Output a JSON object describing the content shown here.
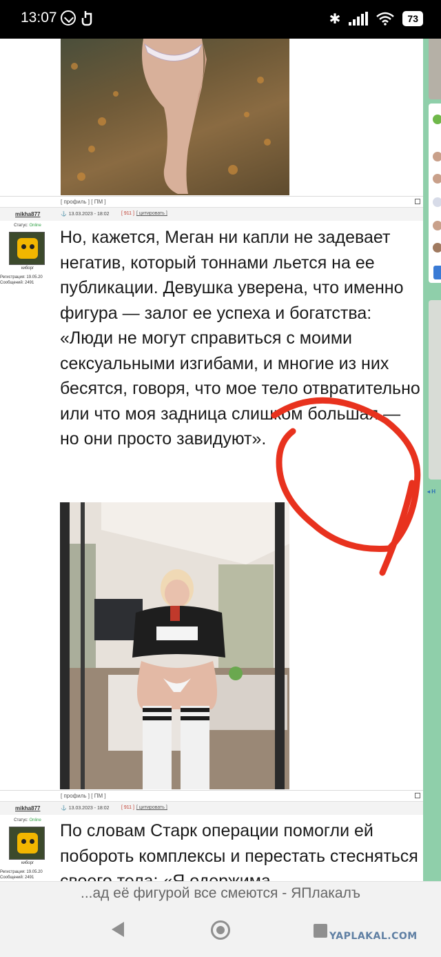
{
  "status_bar": {
    "time": "13:07",
    "battery": "73",
    "icons": [
      "whatsapp-icon",
      "hand-icon",
      "bluetooth-icon",
      "signal-icon",
      "wifi-icon",
      "battery-icon"
    ]
  },
  "posts": [
    {
      "footer_links": [
        "[ профиль ]",
        "[ ПМ ]"
      ]
    },
    {
      "username": "mikha877",
      "date": "13.03.2023 - 18:02",
      "post_number": "[ 911 ]",
      "quote_link": "[ цитировать ]",
      "status_label": "Статус:",
      "status_value": "Online",
      "rank": "киборг",
      "registration": "Регистрация: 19.05.20",
      "messages": "Сообщений: 2491",
      "text": "Но, кажется, Меган ни капли не задевает негатив, который тоннами льется на ее публикации. Девушка уверена, что именно фигура — залог ее успеха и богатства: «Люди не могут справиться с моими сексуальными изгибами, и многие из них бесятся, говоря, что мое тело отвратительно или что моя задница слишком большая — но они просто завидуют».",
      "footer_links": [
        "[ профиль ]",
        "[ ПМ ]"
      ]
    },
    {
      "username": "mikha877",
      "date": "13.03.2023 - 18:02",
      "post_number": "[ 911 ]",
      "quote_link": "[ цитировать ]",
      "status_label": "Статус:",
      "status_value": "Online",
      "rank": "киборг",
      "registration": "Регистрация: 19.05.20",
      "messages": "Сообщений: 2491",
      "text": "По словам Старк операции помогли ей побороть комплексы и перестать стесняться своего тела: «Я одержима"
    }
  ],
  "url_bar": {
    "title": "...ад её фигурой все смеются - ЯПлакалъ"
  },
  "nav": {
    "watermark": "YAPLAKAL.COM"
  },
  "annotation": {
    "color": "#e8321e"
  }
}
